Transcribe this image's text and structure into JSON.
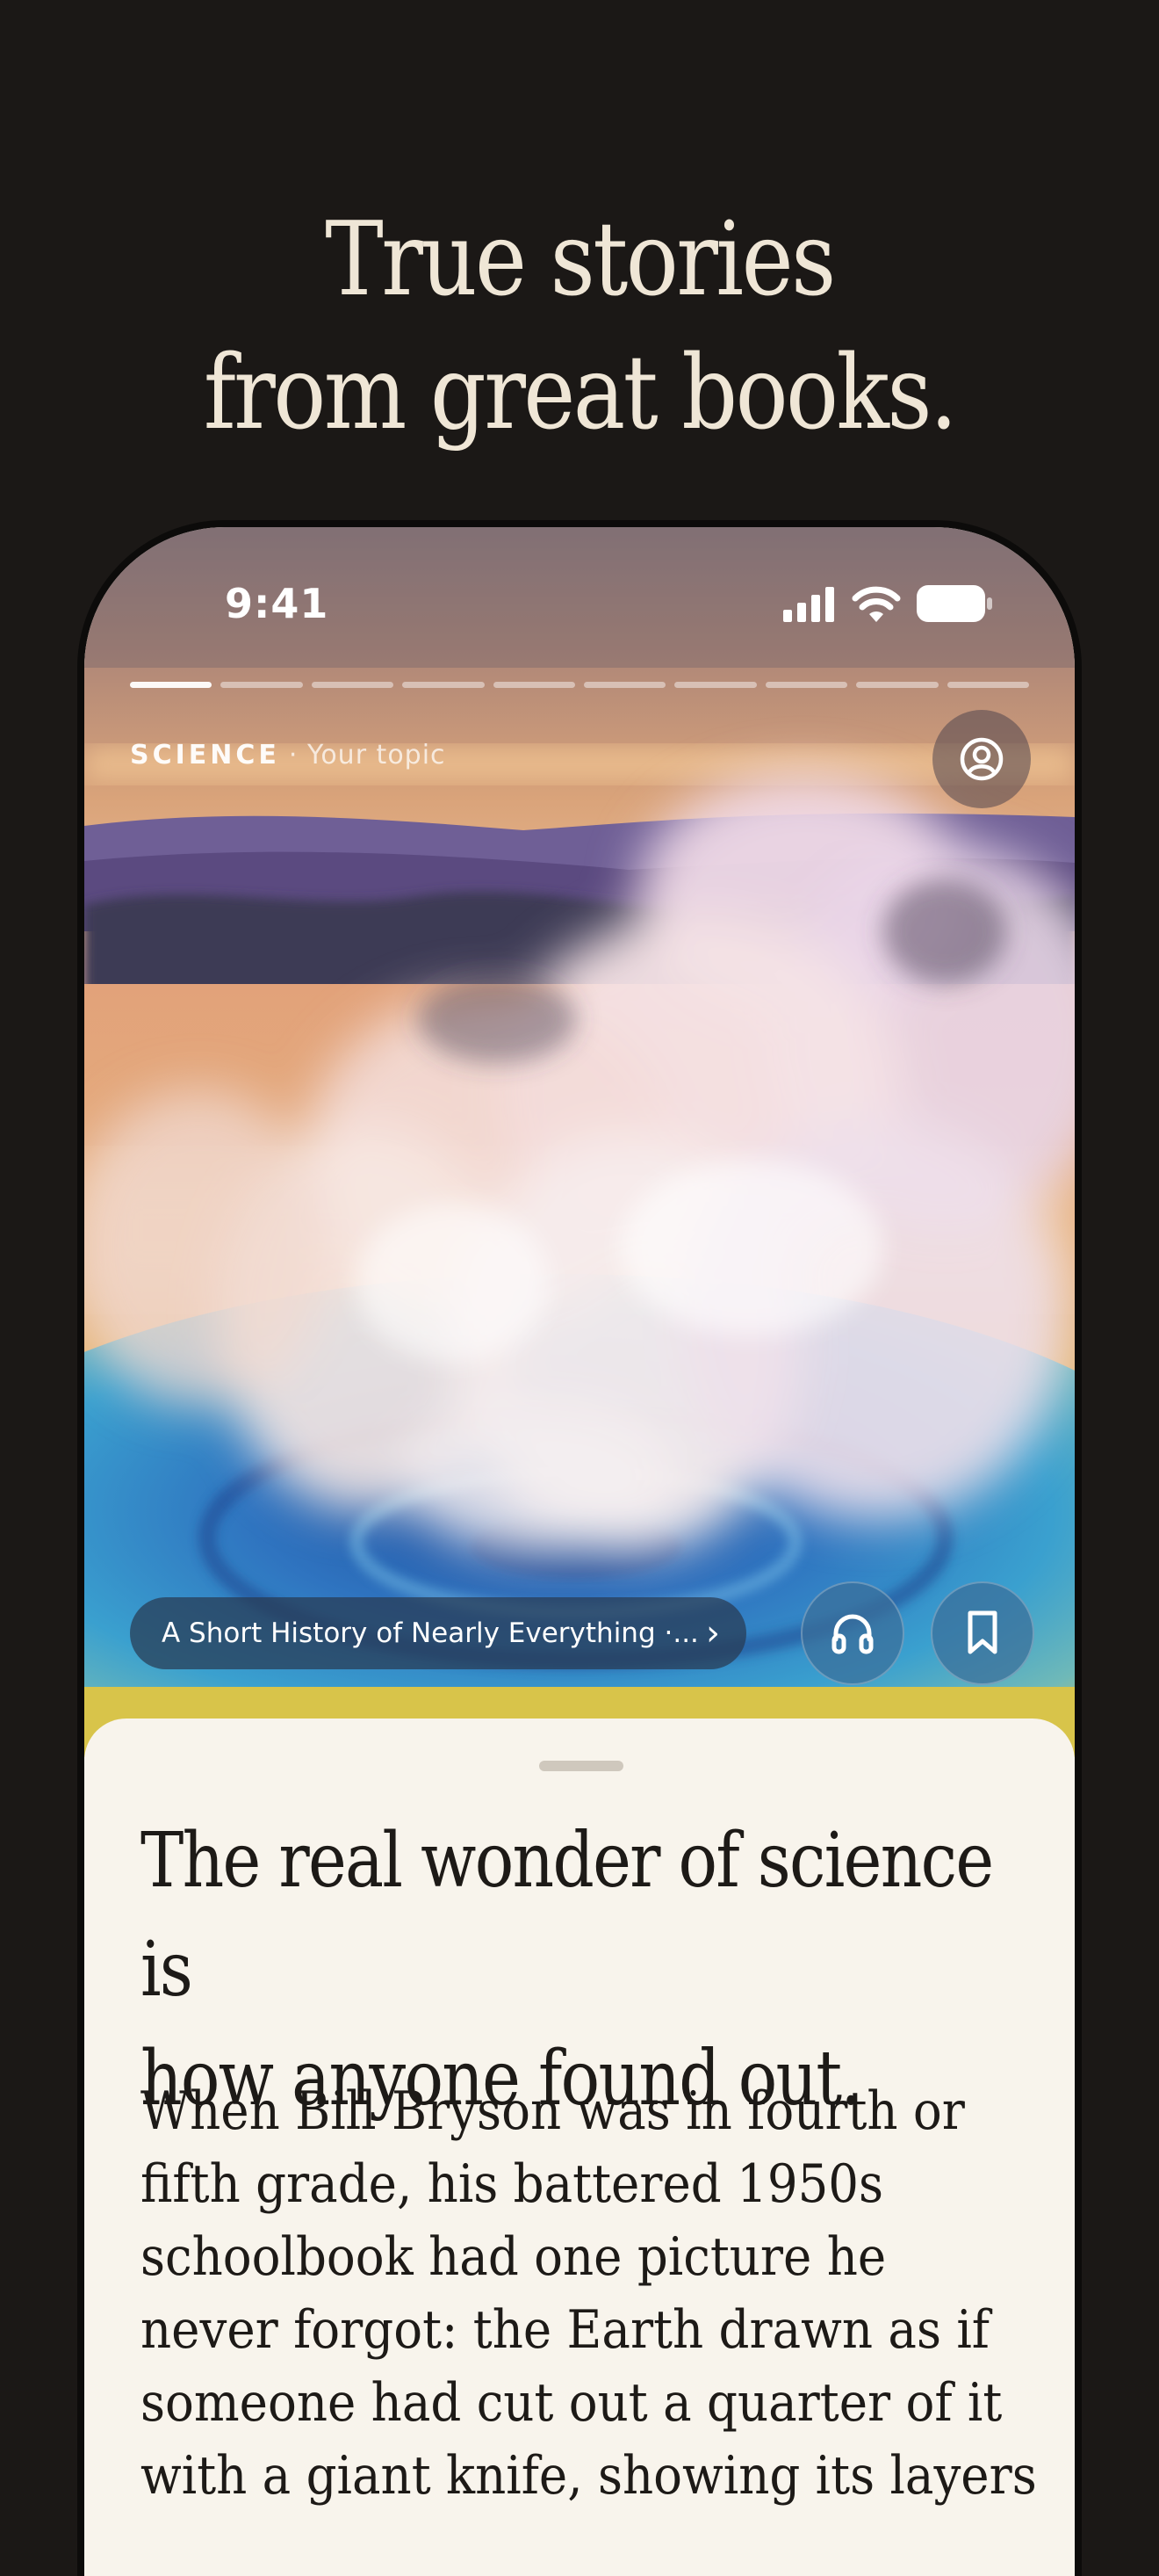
{
  "promo": {
    "headline_line1": "True stories",
    "headline_line2": "from great books."
  },
  "status_bar": {
    "time": "9:41",
    "icons": [
      "signal-icon",
      "wifi-icon",
      "battery-icon"
    ]
  },
  "story_progress": {
    "total_segments": 10,
    "current_segment": 1
  },
  "topic": {
    "category": "SCIENCE",
    "subtitle": "· Your topic"
  },
  "book": {
    "title": "A Short History of Nearly Everything ·...",
    "chevron": "›"
  },
  "actions": {
    "listen_icon": "headphones-icon",
    "save_icon": "bookmark-icon",
    "profile_icon": "profile-icon"
  },
  "story": {
    "title_line1": "The real wonder of science is",
    "title_line2": "how anyone found out.",
    "body_lines": [
      "When Bill Bryson was in fourth or",
      "fifth grade, his battered 1950s",
      "schoolbook had one picture he",
      "never forgot: the Earth drawn as if",
      "someone had cut out a quarter of it",
      "with a giant knife, showing its layers"
    ]
  },
  "colors": {
    "page_background": "#1b1816",
    "headline_text": "#efe6d6",
    "sheet_background": "#f8f4ec",
    "body_text": "#1d1a17"
  }
}
